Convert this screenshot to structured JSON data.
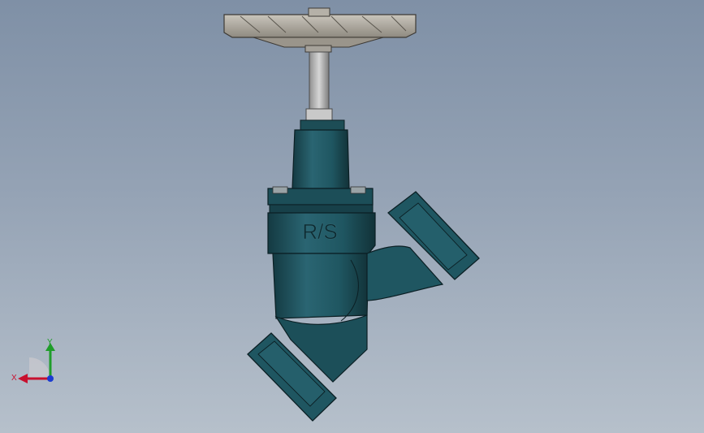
{
  "model": {
    "body_marking": "R/S",
    "colors": {
      "background_top": "#7f90a6",
      "background_bottom": "#b6c0cb",
      "valve_body": "#1f5661",
      "valve_shadow": "#153d45",
      "valve_highlight": "#3d7a86",
      "handwheel": "#a8a39a",
      "stem": "#b8b8b8"
    }
  },
  "triad": {
    "x_label": "X",
    "y_label": "Y",
    "x_color": "#c8102e",
    "y_color": "#1f9d2a",
    "z_color": "#1b3bd1"
  }
}
